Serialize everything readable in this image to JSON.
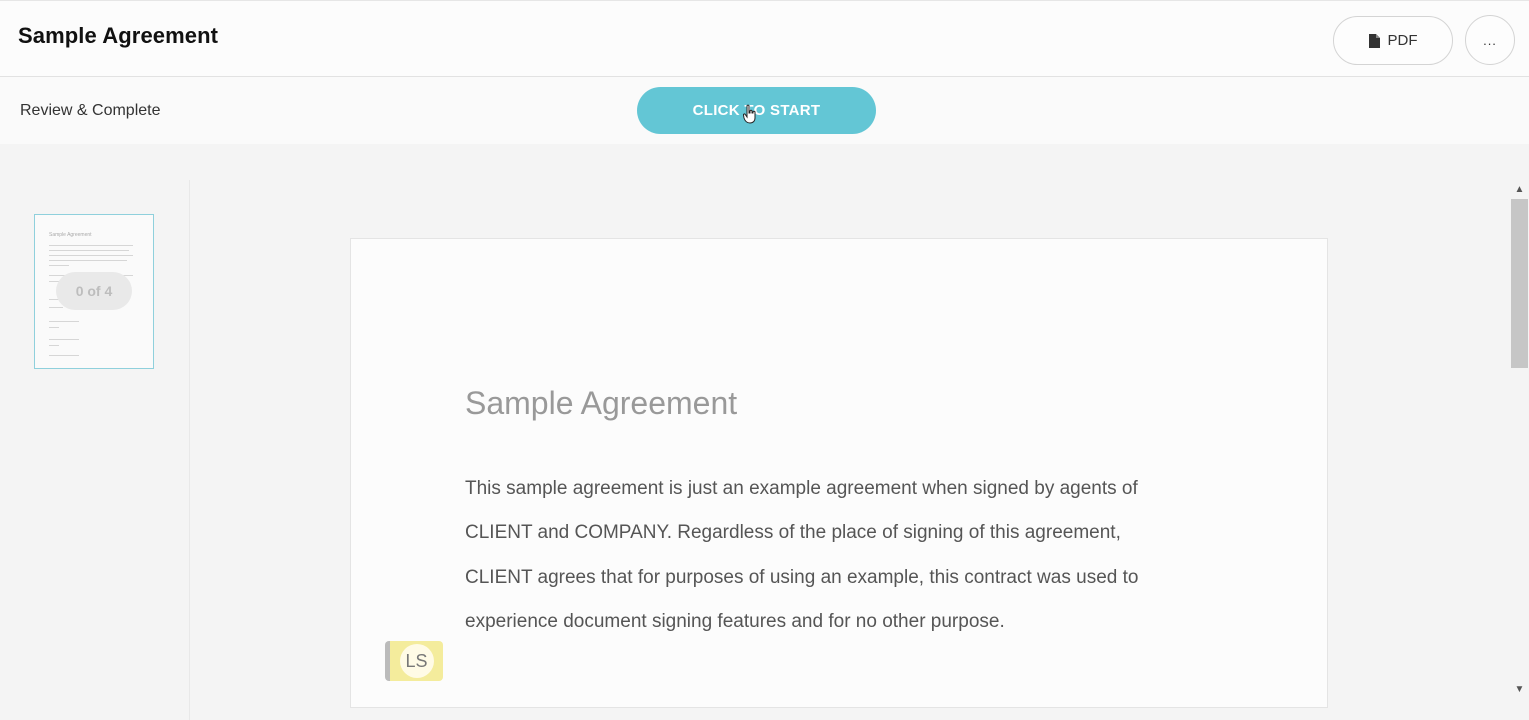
{
  "header": {
    "title": "Sample Agreement",
    "pdf_label": "PDF",
    "more_label": "..."
  },
  "subbar": {
    "review_label": "Review & Complete",
    "start_label": "CLICK TO START"
  },
  "thumbnail": {
    "badge": "0 of 4",
    "title": "Sample Agreement"
  },
  "document": {
    "title": "Sample Agreement",
    "body": "This sample agreement is just an example agreement when signed by agents of CLIENT and COMPANY. Regardless of the place of signing of this agreement, CLIENT agrees that for purposes of using an example, this contract was used to experience document signing features and for no other purpose.",
    "initials": "LS"
  },
  "colors": {
    "accent": "#63c6d5",
    "initials_bg": "#f4ec9c"
  },
  "icons": {
    "pdf": "file-icon",
    "cursor": "hand-pointer-icon"
  }
}
